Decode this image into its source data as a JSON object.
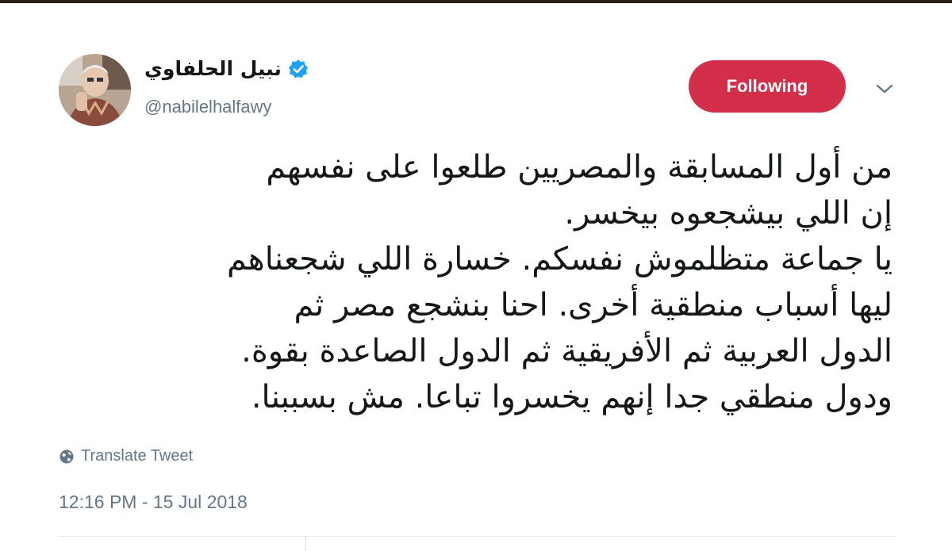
{
  "user": {
    "display_name": "نبيل الحلفاوي",
    "handle": "@nabilelhalfawy",
    "verified": true
  },
  "follow_button": {
    "label": "Following",
    "color": "#d32f4a"
  },
  "tweet": {
    "lines": [
      "من أول المسابقة والمصريين طلعوا على نفسهم",
      "إن اللي بيشجعوه بيخسر.",
      "يا جماعة متظلموش نفسكم. خسارة اللي شجعناهم",
      "ليها أسباب منطقية أخرى. احنا بنشجع مصر ثم",
      "الدول العربية ثم الأفريقية ثم الدول الصاعدة بقوة.",
      "ودول منطقي جدا إنهم يخسروا تباعا. مش بسببنا."
    ],
    "translate_label": "Translate Tweet",
    "timestamp": "12:16 PM - 15 Jul 2018"
  },
  "icons": {
    "verified": "verified-badge-icon",
    "caret": "chevron-down-icon",
    "globe": "globe-icon"
  },
  "colors": {
    "verified": "#1da1f2",
    "secondary_text": "#657786",
    "primary_text": "#14171a"
  }
}
